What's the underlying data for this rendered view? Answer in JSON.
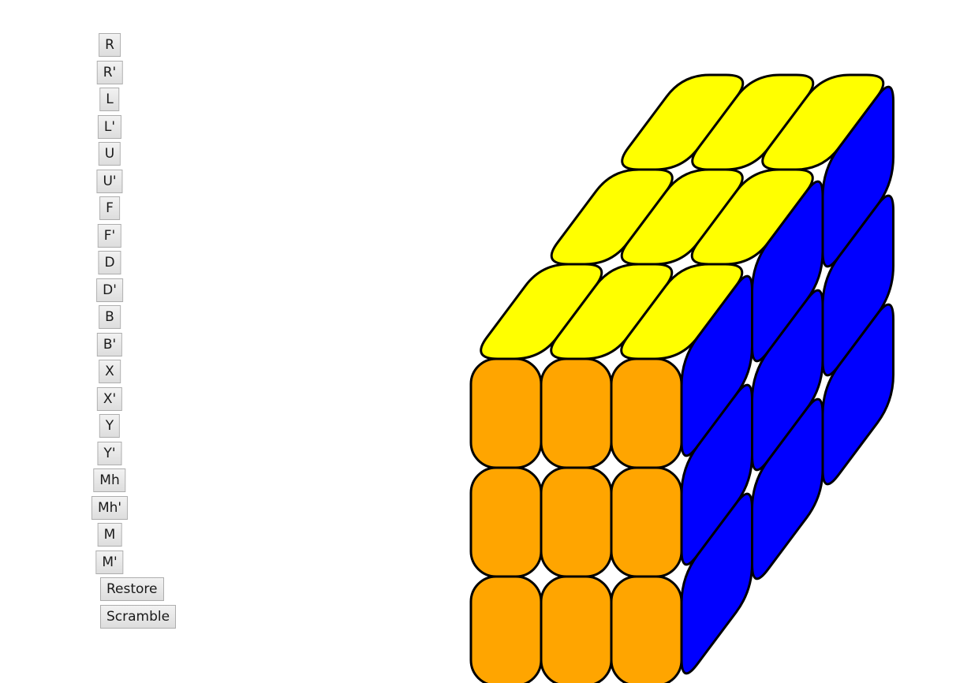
{
  "controls": {
    "moves": [
      "R",
      "R'",
      "L",
      "L'",
      "U",
      "U'",
      "F",
      "F'",
      "D",
      "D'",
      "B",
      "B'",
      "X",
      "X'",
      "Y",
      "Y'",
      "Mh",
      "Mh'",
      "M",
      "M'"
    ],
    "restore_label": "Restore",
    "scramble_label": "Scramble"
  },
  "cube": {
    "colors": {
      "top": "#ffff00",
      "front": "#ffa500",
      "right": "#0000ff",
      "outline": "#000000"
    },
    "faces": {
      "top": [
        [
          "yellow",
          "yellow",
          "yellow"
        ],
        [
          "yellow",
          "yellow",
          "yellow"
        ],
        [
          "yellow",
          "yellow",
          "yellow"
        ]
      ],
      "front": [
        [
          "orange",
          "orange",
          "orange"
        ],
        [
          "orange",
          "orange",
          "orange"
        ],
        [
          "orange",
          "orange",
          "orange"
        ]
      ],
      "right": [
        [
          "blue",
          "blue",
          "blue"
        ],
        [
          "blue",
          "blue",
          "blue"
        ],
        [
          "blue",
          "blue",
          "blue"
        ]
      ]
    }
  }
}
